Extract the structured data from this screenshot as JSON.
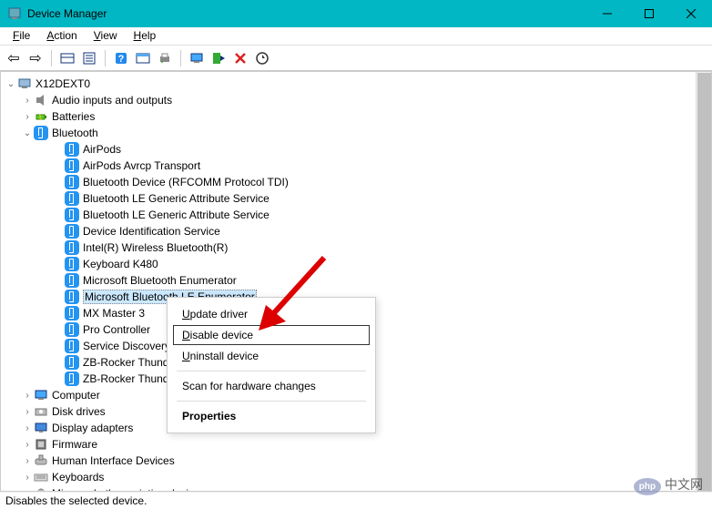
{
  "title": "Device Manager",
  "window_controls": {
    "min": "minimize",
    "max": "maximize",
    "close": "close"
  },
  "menubar": [
    {
      "label": "File",
      "key": "F"
    },
    {
      "label": "Action",
      "key": "A"
    },
    {
      "label": "View",
      "key": "V"
    },
    {
      "label": "Help",
      "key": "H"
    }
  ],
  "toolbar": [
    {
      "name": "back",
      "glyph": "⇦"
    },
    {
      "name": "forward",
      "glyph": "⇨"
    },
    {
      "name": "sep"
    },
    {
      "name": "show-hidden",
      "glyph": "▦"
    },
    {
      "name": "properties",
      "glyph": "▤"
    },
    {
      "name": "sep"
    },
    {
      "name": "help",
      "glyph": "?"
    },
    {
      "name": "refresh",
      "glyph": "▦"
    },
    {
      "name": "print",
      "glyph": "⎙"
    },
    {
      "name": "sep"
    },
    {
      "name": "scan",
      "glyph": "🖵"
    },
    {
      "name": "add-legacy",
      "glyph": "▸"
    },
    {
      "name": "disable",
      "glyph": "✕"
    },
    {
      "name": "update",
      "glyph": "⟳"
    }
  ],
  "tree": {
    "root": {
      "label": "X12DEXT0",
      "expanded": true
    },
    "categories": [
      {
        "label": "Audio inputs and outputs",
        "icon": "speaker",
        "expanded": false
      },
      {
        "label": "Batteries",
        "icon": "battery",
        "expanded": false
      },
      {
        "label": "Bluetooth",
        "icon": "bluetooth",
        "expanded": true,
        "children": [
          "AirPods",
          "AirPods Avrcp Transport",
          "Bluetooth Device (RFCOMM Protocol TDI)",
          "Bluetooth LE Generic Attribute Service",
          "Bluetooth LE Generic Attribute Service",
          "Device Identification Service",
          "Intel(R) Wireless Bluetooth(R)",
          "Keyboard K480",
          "Microsoft Bluetooth Enumerator",
          "Microsoft Bluetooth LE Enumerator",
          "MX Master 3",
          "Pro Controller",
          "Service Discovery",
          "ZB-Rocker Thund",
          "ZB-Rocker Thund"
        ],
        "selected_index": 9
      },
      {
        "label": "Computer",
        "icon": "computer",
        "expanded": false
      },
      {
        "label": "Disk drives",
        "icon": "disk",
        "expanded": false
      },
      {
        "label": "Display adapters",
        "icon": "display",
        "expanded": false
      },
      {
        "label": "Firmware",
        "icon": "firmware",
        "expanded": false
      },
      {
        "label": "Human Interface Devices",
        "icon": "hid",
        "expanded": false
      },
      {
        "label": "Keyboards",
        "icon": "keyboard",
        "expanded": false
      },
      {
        "label": "Mice and other pointing devices",
        "icon": "mouse",
        "expanded": false
      }
    ]
  },
  "context_menu": {
    "items": [
      {
        "label": "Update driver",
        "key": "U"
      },
      {
        "label": "Disable device",
        "key": "D",
        "selected": true
      },
      {
        "label": "Uninstall device",
        "key": "U"
      },
      {
        "sep": true
      },
      {
        "label": "Scan for hardware changes",
        "key": ""
      },
      {
        "sep": true
      },
      {
        "label": "Properties",
        "key": "R",
        "bold": true
      }
    ]
  },
  "statusbar": "Disables the selected device.",
  "watermark": "中文网"
}
